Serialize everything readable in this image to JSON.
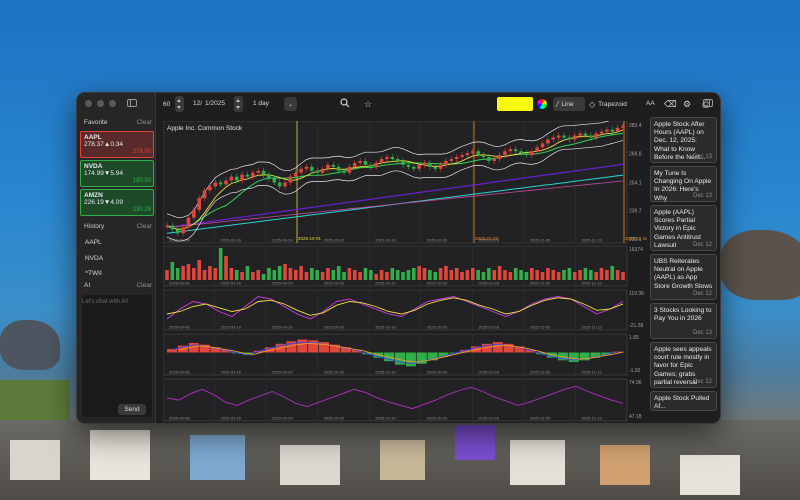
{
  "sidebar": {
    "favorite_label": "Favorite",
    "clear_label": "Clear",
    "favorites": [
      {
        "symbol": "AAPL",
        "price": "278.37▲0.34",
        "tag": "278.00",
        "tag_color": "#e0463c",
        "bg": "#5a2a2a"
      },
      {
        "symbol": "NVDA",
        "price": "174.99▼5.94",
        "tag": "180.93",
        "tag_color": "#2fae4a",
        "bg": "#1f4a2a"
      },
      {
        "symbol": "AMZN",
        "price": "226.19▼4.09",
        "tag": "230.28",
        "tag_color": "#2fae4a",
        "bg": "#1f4a2a"
      }
    ],
    "history_label": "History",
    "history": [
      "AAPL",
      "NVDA",
      "^TWII"
    ],
    "ai_label": "AI",
    "chat_placeholder": "Let's chat with AI!",
    "send_label": "Send"
  },
  "toolbar": {
    "interval_value": "60",
    "date_month": "12/",
    "date_value": "1/2025",
    "range_label": "1 day",
    "line_label": "Line",
    "trapezoid_label": "Trapezoid",
    "font_label": "AA",
    "highlight_color": "#f8f810"
  },
  "chart": {
    "title": "Apple Inc. Common Stock",
    "price_ticks": [
      "283.4",
      "268.8",
      "254.1",
      "239.7",
      "225.1"
    ],
    "vline_labels": [
      "2025-10-01",
      "2025-21-03",
      "2025-11-16"
    ],
    "x_ticks": [
      "2025-09-08",
      "2025-09-16",
      "2025-09-24",
      "2025-10-02",
      "2025-10-10",
      "2025-10-20",
      "2025-10-28",
      "2025-11-05",
      "2025-11-13"
    ],
    "volume_max": "16374",
    "kd_ticks": [
      "119.36",
      "-21.28"
    ],
    "macd_ticks": [
      "1.85",
      "-1.92"
    ],
    "rsi_ticks": [
      "74.96",
      "47.18"
    ]
  },
  "chart_data": {
    "type": "candlestick",
    "title": "Apple Inc. Common Stock",
    "ylim": [
      225.1,
      283.4
    ],
    "close": [
      232,
      230,
      228,
      231,
      236,
      240,
      246,
      250,
      252,
      254,
      253,
      255,
      257,
      255,
      258,
      257,
      259,
      260,
      258,
      256,
      254,
      252,
      254,
      257,
      259,
      261,
      262,
      260,
      259,
      261,
      263,
      262,
      260,
      259,
      262,
      264,
      265,
      263,
      262,
      264,
      266,
      267,
      266,
      265,
      263,
      262,
      261,
      263,
      264,
      262,
      261,
      263,
      265,
      266,
      267,
      268,
      269,
      270,
      268,
      267,
      265,
      266,
      268,
      270,
      271,
      270,
      269,
      268,
      270,
      272,
      274,
      276,
      277,
      278,
      277,
      276,
      278,
      279,
      278,
      277,
      279,
      280,
      281,
      280,
      282,
      283
    ],
    "volume": [
      5,
      9,
      6,
      7,
      8,
      6,
      10,
      5,
      7,
      6,
      16,
      12,
      6,
      5,
      4,
      7,
      4,
      5,
      3,
      6,
      5,
      7,
      8,
      6,
      5,
      7,
      4,
      6,
      5,
      4,
      6,
      5,
      7,
      4,
      6,
      5,
      4,
      6,
      5,
      3,
      5,
      4,
      6,
      5,
      4,
      5,
      6,
      7,
      6,
      5,
      4,
      6,
      7,
      5,
      6,
      4,
      5,
      6,
      5,
      4,
      6,
      5,
      7,
      5,
      4,
      6,
      5,
      4,
      6,
      5,
      4,
      6,
      5,
      4,
      5,
      6,
      4,
      5,
      6,
      5,
      4,
      6,
      5,
      7,
      5,
      4
    ],
    "kd_k": [
      10,
      50,
      80,
      70,
      40,
      20,
      60,
      100,
      90,
      60,
      30,
      10,
      40,
      80,
      90,
      70,
      50,
      30,
      20,
      50,
      80,
      90,
      100,
      80,
      60,
      40,
      20,
      40,
      70,
      90,
      100,
      90,
      60,
      30,
      50,
      80
    ],
    "kd_d": [
      30,
      40,
      60,
      70,
      55,
      40,
      50,
      80,
      85,
      70,
      45,
      25,
      35,
      65,
      80,
      75,
      60,
      40,
      30,
      45,
      70,
      85,
      95,
      85,
      65,
      50,
      30,
      40,
      65,
      85,
      95,
      90,
      70,
      45,
      50,
      70
    ],
    "macd_hist": [
      0.4,
      0.8,
      1.1,
      0.9,
      0.6,
      0.3,
      -0.1,
      -0.3,
      0.2,
      0.6,
      1.0,
      1.3,
      1.5,
      1.4,
      1.2,
      0.9,
      0.6,
      0.3,
      -0.2,
      -0.6,
      -1.0,
      -1.4,
      -1.6,
      -1.3,
      -0.9,
      -0.5,
      -0.1,
      0.3,
      0.7,
      1.0,
      1.2,
      1.0,
      0.7,
      0.3,
      -0.2,
      -0.6,
      -0.9,
      -1.1,
      -0.9,
      -0.6,
      -0.3,
      0.1
    ],
    "rsi": [
      62,
      60,
      66,
      70,
      65,
      58,
      55,
      60,
      64,
      68,
      63,
      57,
      54,
      58,
      62,
      66,
      70,
      67,
      62,
      58,
      55,
      52,
      56,
      60,
      65,
      69,
      72,
      68,
      63,
      59,
      55,
      58,
      62,
      66,
      70,
      73,
      68,
      64,
      60,
      57
    ]
  },
  "news": [
    {
      "title": "Apple Stock After Hours (AAPL) on Dec. 12, 2025: What to Know Before the Next...",
      "date": "Dec 13"
    },
    {
      "title": "My Tune Is Changing On Apple In 2026: Here's Why",
      "date": "Dec 13"
    },
    {
      "title": "Apple (AAPL) Scores Partial Victory in Epic Games Antitrust Lawsuit",
      "date": "Dec 12"
    },
    {
      "title": "UBS Reiterates Neutral on Apple (AAPL) as App Store Growth Slows",
      "date": "Dec 12"
    },
    {
      "title": "3 Stocks Looking to Pay You in 2026",
      "date": "Dec 13"
    },
    {
      "title": "Apple sees appeals court rule mostly in favor for Epic Games; grabs partial reversal",
      "date": "Dec 12"
    },
    {
      "title": "Apple Stock Pulled Af...",
      "date": ""
    }
  ]
}
